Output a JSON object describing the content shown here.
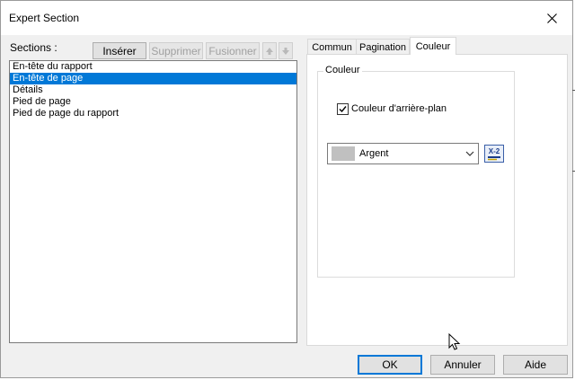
{
  "window": {
    "title": "Expert Section"
  },
  "sections": {
    "label": "Sections :",
    "buttons": {
      "insert": "Insérer",
      "delete": "Supprimer",
      "merge": "Fusionner"
    },
    "items": [
      {
        "label": "En-tête du rapport",
        "selected": false
      },
      {
        "label": "En-tête de page",
        "selected": true
      },
      {
        "label": "Détails",
        "selected": false
      },
      {
        "label": "Pied de page",
        "selected": false
      },
      {
        "label": "Pied de page du rapport",
        "selected": false
      }
    ]
  },
  "tabs": [
    {
      "label": "Commun",
      "active": false
    },
    {
      "label": "Pagination",
      "active": false
    },
    {
      "label": "Couleur",
      "active": true
    }
  ],
  "color_tab": {
    "group_title": "Couleur",
    "background_checkbox_label": "Couleur d'arrière-plan",
    "background_checked": true,
    "color_value": "Argent",
    "swatch_color": "#c0c0c0",
    "formula_label": "X-2"
  },
  "footer": {
    "ok": "OK",
    "cancel": "Annuler",
    "help": "Aide"
  },
  "colors": {
    "selection": "#0078d7",
    "dialog_bg": "#f0f0f0"
  }
}
